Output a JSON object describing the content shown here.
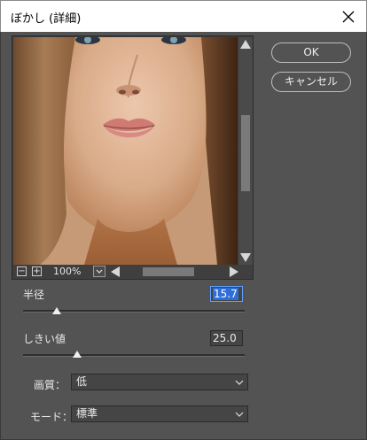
{
  "window": {
    "title": "ぼかし (詳細)",
    "close_icon": "close-icon"
  },
  "buttons": {
    "ok": "OK",
    "cancel": "キャンセル"
  },
  "preview": {
    "zoom": "100%",
    "zoom_out": "−",
    "zoom_in": "+"
  },
  "radius": {
    "label": "半径",
    "value": "15.7",
    "slider_fraction": 0.2
  },
  "threshold": {
    "label": "しきい値",
    "value": "25.0",
    "slider_fraction": 0.25
  },
  "quality": {
    "label": "画質：",
    "value": "低"
  },
  "mode": {
    "label": "モード：",
    "value": "標準"
  },
  "colors": {
    "dialog_bg": "#535353",
    "title_bg": "#ffffff",
    "selection": "#2d6fd6"
  }
}
